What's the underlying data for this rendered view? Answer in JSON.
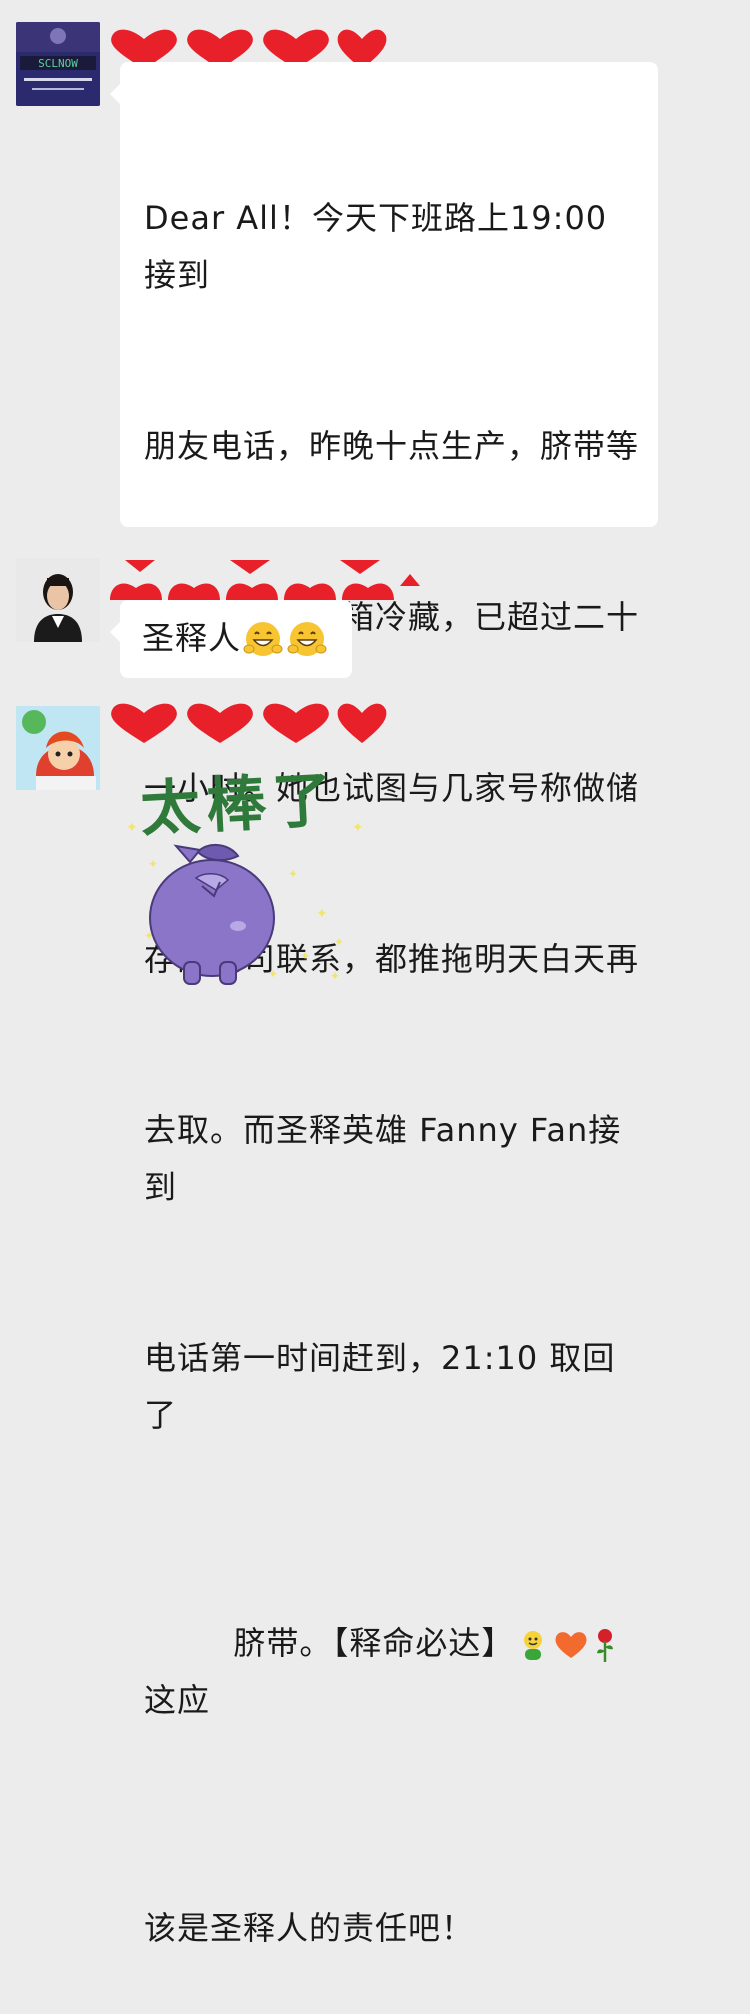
{
  "messages": [
    {
      "sender": "sender-1",
      "avatar_text": "SCLNOW",
      "text_lines": [
        "Dear All！今天下班路上19:00 接到",
        "朋友电话，昨晚十点生产，脐带等",
        "都放在医院冰箱冷藏，已超过二十",
        "一小时。她也试图与几家号称做储",
        "存的公司联系，都推拖明天白天再",
        "去取。而圣释英雄 Fanny Fan接到",
        "电话第一时间赶到，21:10 取回了"
      ],
      "last_line_prefix": "脐带。【释命必达】",
      "last_line_suffix": "这应",
      "final_line": "该是圣释人的责任吧！"
    },
    {
      "sender": "sender-2",
      "text": "圣释人"
    },
    {
      "sender": "sender-3",
      "sticker_text": "太棒了"
    }
  ],
  "colors": {
    "background": "#ececec",
    "bubble": "#ffffff",
    "heart": "#e8202a",
    "sticker_text": "#2f7a3a",
    "sticker_creature": "#8b75c9"
  }
}
